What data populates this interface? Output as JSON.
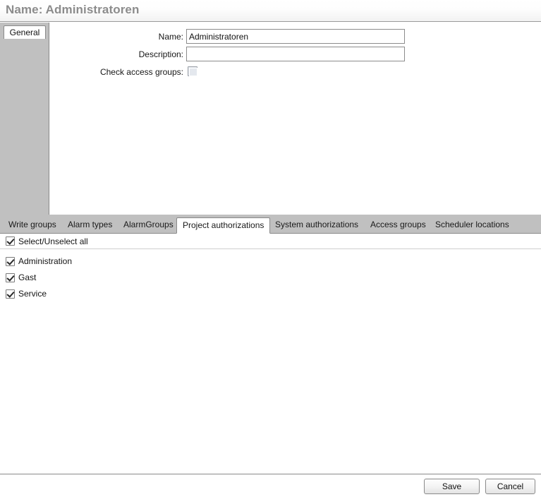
{
  "header": {
    "title": "Name: Administratoren"
  },
  "general": {
    "vertical_tab_label": "General",
    "fields": [
      {
        "label": "Name:",
        "value": "Administratoren",
        "placeholder": ""
      },
      {
        "label": "Description:",
        "value": "",
        "placeholder": ""
      }
    ],
    "checkbox": {
      "label": "Check access groups:",
      "checked": false
    }
  },
  "tabs": {
    "items": [
      {
        "label": "Write groups",
        "active": false
      },
      {
        "label": "Alarm types",
        "active": false
      },
      {
        "label": "AlarmGroups",
        "active": false
      },
      {
        "label": "Project authorizations",
        "active": true
      },
      {
        "label": "System authorizations",
        "active": false
      },
      {
        "label": "Access groups",
        "active": false
      },
      {
        "label": "Scheduler locations",
        "active": false
      }
    ]
  },
  "authorizations": {
    "select_all": {
      "label": "Select/Unselect all",
      "checked": true
    },
    "items": [
      {
        "label": "Administration",
        "checked": true
      },
      {
        "label": "Gast",
        "checked": true
      },
      {
        "label": "Service",
        "checked": true
      }
    ]
  },
  "footer": {
    "save_label": "Save",
    "cancel_label": "Cancel"
  },
  "colors": {
    "tab_strip_bg": "#c0c0c0",
    "title_text": "#8c8c8c",
    "border": "#8a8a8a",
    "panel_bg": "#ffffff"
  }
}
